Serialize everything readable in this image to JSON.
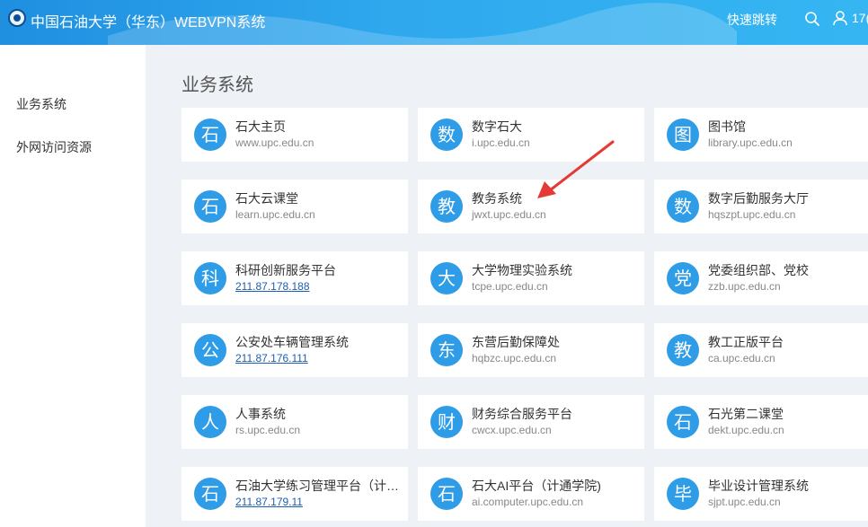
{
  "header": {
    "title": "中国石油大学（华东）WEBVPN系统",
    "quick_jump": "快速跳转",
    "user_id_partial": "17("
  },
  "sidebar": {
    "items": [
      {
        "label": "业务系统"
      },
      {
        "label": "外网访问资源"
      }
    ]
  },
  "section": {
    "title": "业务系统"
  },
  "cards": [
    {
      "badge": "石",
      "name": "石大主页",
      "url": "www.upc.edu.cn"
    },
    {
      "badge": "数",
      "name": "数字石大",
      "url": "i.upc.edu.cn"
    },
    {
      "badge": "图",
      "name": "图书馆",
      "url": "library.upc.edu.cn"
    },
    {
      "badge": "石",
      "name": "石大云课堂",
      "url": "learn.upc.edu.cn"
    },
    {
      "badge": "教",
      "name": "教务系统",
      "url": "jwxt.upc.edu.cn"
    },
    {
      "badge": "数",
      "name": "数字后勤服务大厅",
      "url": "hqszpt.upc.edu.cn"
    },
    {
      "badge": "科",
      "name": "科研创新服务平台",
      "url": "211.87.178.188"
    },
    {
      "badge": "大",
      "name": "大学物理实验系统",
      "url": "tcpe.upc.edu.cn"
    },
    {
      "badge": "党",
      "name": "党委组织部、党校",
      "url": "zzb.upc.edu.cn"
    },
    {
      "badge": "公",
      "name": "公安处车辆管理系统",
      "url": "211.87.176.111"
    },
    {
      "badge": "东",
      "name": "东营后勤保障处",
      "url": "hqbzc.upc.edu.cn"
    },
    {
      "badge": "教",
      "name": "教工正版平台",
      "url": "ca.upc.edu.cn"
    },
    {
      "badge": "人",
      "name": "人事系统",
      "url": "rs.upc.edu.cn"
    },
    {
      "badge": "财",
      "name": "财务综合服务平台",
      "url": "cwcx.upc.edu.cn"
    },
    {
      "badge": "石",
      "name": "石光第二课堂",
      "url": "dekt.upc.edu.cn"
    },
    {
      "badge": "石",
      "name": "石油大学练习管理平台（计…",
      "url": "211.87.179.11"
    },
    {
      "badge": "石",
      "name": "石大AI平台（计通学院)",
      "url": "ai.computer.upc.edu.cn"
    },
    {
      "badge": "毕",
      "name": "毕业设计管理系统",
      "url": "sjpt.upc.edu.cn"
    }
  ],
  "colors": {
    "accent": "#2e9ce6",
    "header": "#2fa8ee",
    "annotation_arrow": "#e53935",
    "link": "#1a5fb4"
  }
}
